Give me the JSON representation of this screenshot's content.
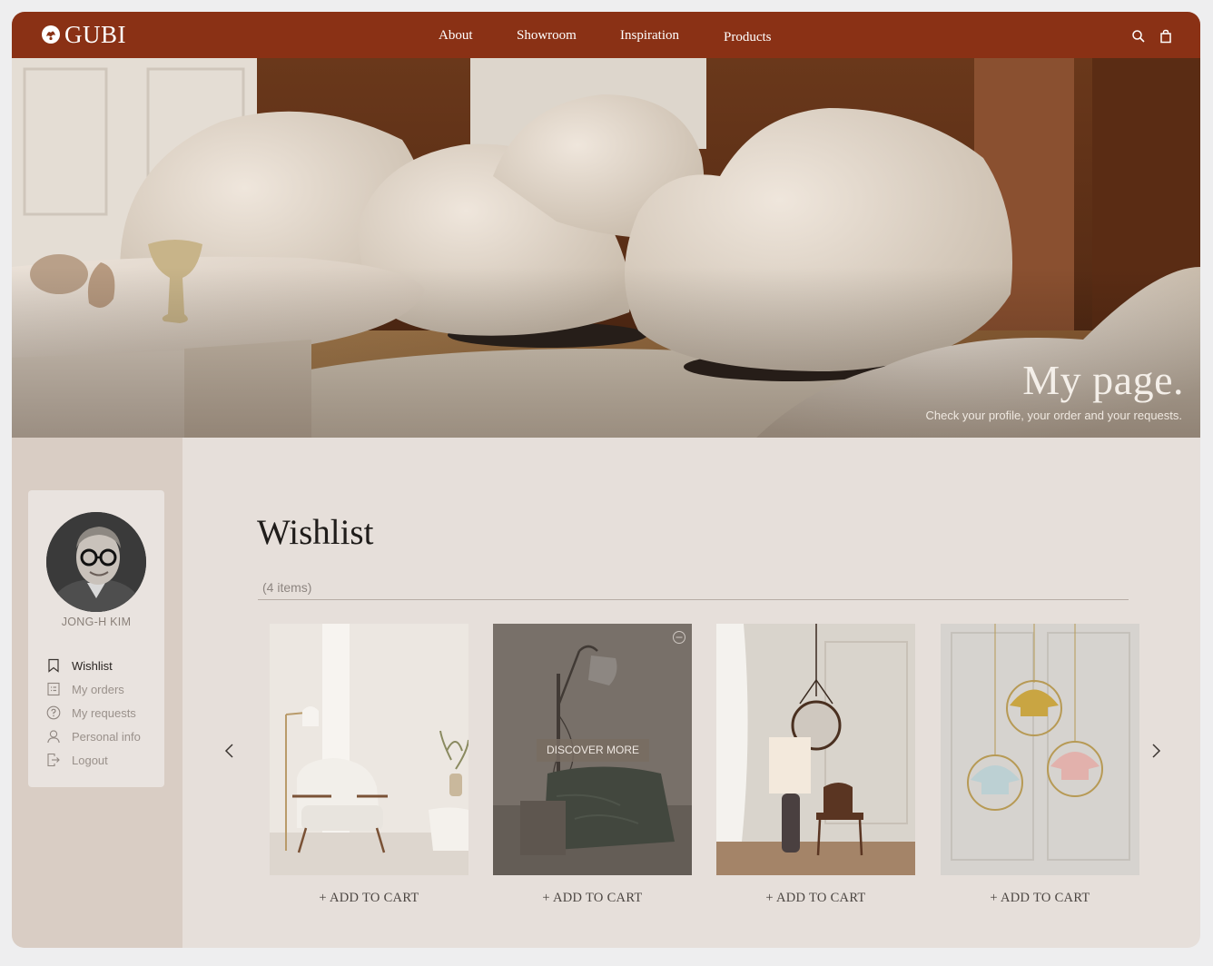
{
  "brand": {
    "name": "GUBI"
  },
  "nav": {
    "items": [
      {
        "label": "About"
      },
      {
        "label": "Showroom"
      },
      {
        "label": "Inspiration"
      },
      {
        "label": "Products"
      }
    ],
    "icons": [
      "search-icon",
      "shopping-bag-icon"
    ]
  },
  "hero": {
    "title": "My page.",
    "subtitle": "Check your profile, your order and your requests."
  },
  "profile": {
    "name": "JONG-H KIM",
    "menu": [
      {
        "label": "Wishlist",
        "icon": "bookmark-icon",
        "active": true
      },
      {
        "label": "My orders",
        "icon": "orders-list-icon",
        "active": false
      },
      {
        "label": "My requests",
        "icon": "question-icon",
        "active": false
      },
      {
        "label": "Personal info",
        "icon": "user-icon",
        "active": false
      },
      {
        "label": "Logout",
        "icon": "logout-icon",
        "active": false
      }
    ]
  },
  "wishlist": {
    "title": "Wishlist",
    "count_label": "(4 items)",
    "discover_label": "DISCOVER MORE",
    "items": [
      {
        "add_label": "+ ADD TO CART"
      },
      {
        "add_label": "+ ADD TO CART"
      },
      {
        "add_label": "+ ADD TO CART"
      },
      {
        "add_label": "+ ADD TO CART"
      }
    ]
  },
  "colors": {
    "header": "#8a3115",
    "sidebar": "#d9cdc4",
    "background": "#e6dfda"
  }
}
